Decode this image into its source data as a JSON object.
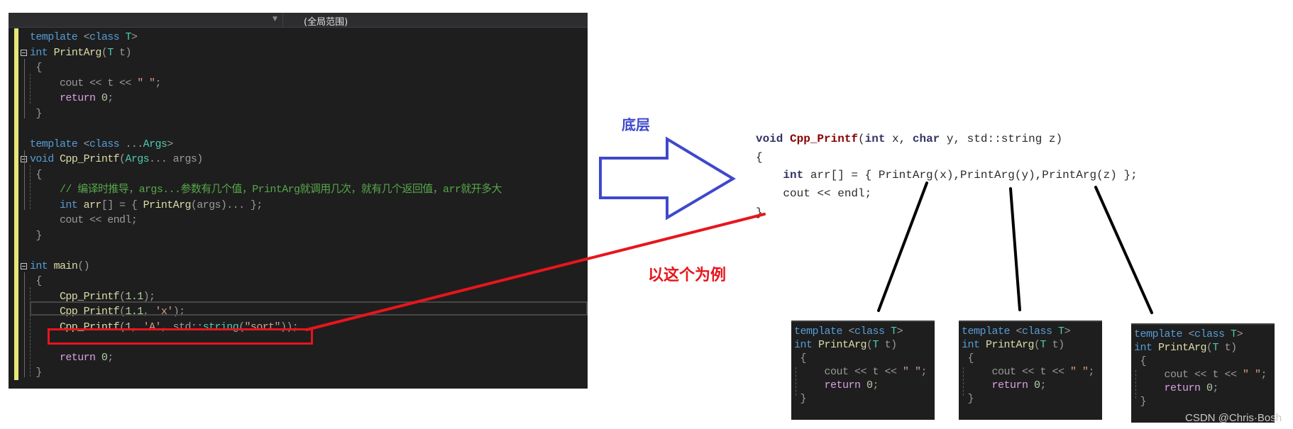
{
  "editor": {
    "scope_dropdown": "(全局范围)",
    "lines": [
      {
        "row": 0,
        "fold": false,
        "tokens": [
          [
            "kw",
            "template "
          ],
          [
            "pm",
            "<"
          ],
          [
            "kw",
            "class "
          ],
          [
            "ty",
            "T"
          ],
          [
            "pm",
            ">"
          ]
        ]
      },
      {
        "row": 1,
        "fold": true,
        "tokens": [
          [
            "kw",
            "int "
          ],
          [
            "fn",
            "PrintArg"
          ],
          [
            "pm",
            "("
          ],
          [
            "ty",
            "T "
          ],
          [
            "pm",
            "t)"
          ]
        ]
      },
      {
        "row": 2,
        "fold": false,
        "tokens": [
          [
            "pm",
            " {"
          ]
        ]
      },
      {
        "row": 3,
        "fold": false,
        "tokens": [
          [
            "pm",
            "     cout << t << "
          ],
          [
            "st",
            "\" \""
          ],
          [
            "pm",
            ";"
          ]
        ]
      },
      {
        "row": 4,
        "fold": false,
        "tokens": [
          [
            "rt",
            "     return "
          ],
          [
            "nm",
            "0"
          ],
          [
            "pm",
            ";"
          ]
        ]
      },
      {
        "row": 5,
        "fold": false,
        "tokens": [
          [
            "pm",
            " }"
          ]
        ]
      },
      {
        "row": 7,
        "fold": false,
        "tokens": [
          [
            "kw",
            "template "
          ],
          [
            "pm",
            "<"
          ],
          [
            "kw",
            "class "
          ],
          [
            "pm",
            "..."
          ],
          [
            "ty",
            "Args"
          ],
          [
            "pm",
            ">"
          ]
        ]
      },
      {
        "row": 8,
        "fold": true,
        "tokens": [
          [
            "kw",
            "void "
          ],
          [
            "fn",
            "Cpp_Printf"
          ],
          [
            "pm",
            "("
          ],
          [
            "ty",
            "Args"
          ],
          [
            "pm",
            "... args)"
          ]
        ]
      },
      {
        "row": 9,
        "fold": false,
        "tokens": [
          [
            "pm",
            " {"
          ]
        ]
      },
      {
        "row": 10,
        "fold": false,
        "tokens": [
          [
            "ct",
            "     // 编译时推导，args...参数有几个值，PrintArg就调用几次，就有几个返回值，arr就开多大"
          ]
        ]
      },
      {
        "row": 11,
        "fold": false,
        "tokens": [
          [
            "kw",
            "     int "
          ],
          [
            "fn",
            "arr"
          ],
          [
            "pm",
            "[] = { "
          ],
          [
            "fn",
            "PrintArg"
          ],
          [
            "pm",
            "(args)... };"
          ]
        ]
      },
      {
        "row": 12,
        "fold": false,
        "tokens": [
          [
            "pm",
            "     cout << endl;"
          ]
        ]
      },
      {
        "row": 13,
        "fold": false,
        "tokens": [
          [
            "pm",
            " }"
          ]
        ]
      },
      {
        "row": 15,
        "fold": true,
        "tokens": [
          [
            "kw",
            "int "
          ],
          [
            "fn",
            "main"
          ],
          [
            "pm",
            "()"
          ]
        ]
      },
      {
        "row": 16,
        "fold": false,
        "tokens": [
          [
            "pm",
            " {"
          ]
        ]
      },
      {
        "row": 17,
        "fold": false,
        "tokens": [
          [
            "fn",
            "     Cpp_Printf"
          ],
          [
            "pm",
            "("
          ],
          [
            "nm",
            "1.1"
          ],
          [
            "pm",
            ");"
          ]
        ]
      },
      {
        "row": 18,
        "fold": false,
        "tokens": [
          [
            "fn",
            "     Cpp_Printf"
          ],
          [
            "pm",
            "("
          ],
          [
            "nm",
            "1.1"
          ],
          [
            "pm",
            ", "
          ],
          [
            "st",
            "'x'"
          ],
          [
            "pm",
            ");"
          ]
        ]
      },
      {
        "row": 19,
        "fold": false,
        "tokens": [
          [
            "fn",
            "     Cpp_Printf"
          ],
          [
            "pm",
            "("
          ],
          [
            "nm",
            "1"
          ],
          [
            "pm",
            ", "
          ],
          [
            "st",
            "'A'"
          ],
          [
            "pm",
            ", std::"
          ],
          [
            "ty",
            "string"
          ],
          [
            "pm",
            "("
          ],
          [
            "st",
            "\"sort\""
          ],
          [
            "pm",
            "));"
          ]
        ]
      },
      {
        "row": 21,
        "fold": false,
        "tokens": [
          [
            "rt",
            "     return "
          ],
          [
            "nm",
            "0"
          ],
          [
            "pm",
            ";"
          ]
        ]
      },
      {
        "row": 22,
        "fold": false,
        "tokens": [
          [
            "pm",
            " }"
          ]
        ]
      }
    ],
    "highlighted_call": "Cpp_Printf(1, 'A', std::string(\"sort\"));"
  },
  "annotations": {
    "arrow_label": "底层",
    "example_label": "以这个为例",
    "colors": {
      "arrow": "#3f48cc",
      "example": "#e8151d",
      "connector": "#000000"
    }
  },
  "expanded": {
    "lines": [
      [
        [
          "rkw",
          "void "
        ],
        [
          "rfn",
          "Cpp_Printf"
        ],
        [
          "t",
          "("
        ],
        [
          "rkw",
          "int "
        ],
        [
          "t",
          "x, "
        ],
        [
          "rkw",
          "char "
        ],
        [
          "t",
          "y, std::string z)"
        ]
      ],
      [
        [
          "t",
          "{"
        ]
      ],
      [
        [
          "t",
          "    "
        ],
        [
          "rkw",
          "int "
        ],
        [
          "t",
          "arr[] = { PrintArg(x),PrintArg(y),PrintArg(z) };"
        ]
      ],
      [
        [
          "t",
          "    cout << endl;"
        ]
      ],
      [
        [
          "t",
          "}"
        ]
      ]
    ]
  },
  "instances": [
    {
      "lines": [
        "template <class T>",
        "int PrintArg(T t)",
        " {",
        "     cout << t << \" \";",
        "     return 0;",
        " }"
      ]
    },
    {
      "lines": [
        "template <class T>",
        "int PrintArg(T t)",
        " {",
        "     cout << t << \" \";",
        "     return 0;",
        " }"
      ]
    },
    {
      "lines": [
        "template <class T>",
        "int PrintArg(T t)",
        " {",
        "     cout << t << \" \";",
        "     return 0;",
        " }"
      ]
    }
  ],
  "watermark": "CSDN @Chris·Bosh"
}
